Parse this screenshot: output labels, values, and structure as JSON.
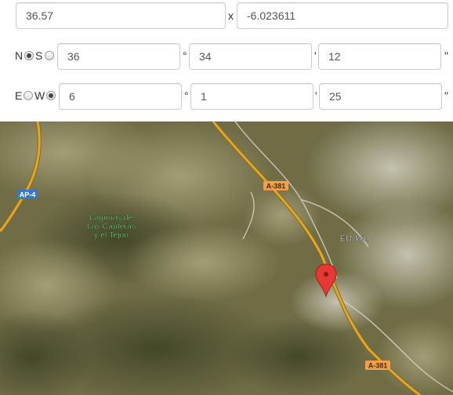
{
  "coordinates": {
    "lat_decimal": "36.57",
    "separator": "x",
    "lng_decimal": "-6.023611"
  },
  "latitude_row": {
    "north_label": "N",
    "south_label": "S",
    "selected": "N",
    "degrees": "36",
    "minutes": "34",
    "seconds": "12",
    "degree_symbol": "°",
    "minute_symbol": "'",
    "second_symbol": "\""
  },
  "longitude_row": {
    "east_label": "E",
    "west_label": "W",
    "selected": "W",
    "degrees": "6",
    "minutes": "1",
    "seconds": "25",
    "degree_symbol": "°",
    "minute_symbol": "'",
    "second_symbol": "\""
  },
  "map": {
    "type": "satellite",
    "labels": {
      "place_line1": "Lagunas de",
      "place_line2": "Las Canteras",
      "place_line3": "y el Tejón",
      "town": "El Mojo",
      "road_ap4": "AP-4",
      "road_a381_top": "A-381",
      "road_a381_bottom": "A-381"
    },
    "colors": {
      "road": "#d9a227",
      "shield_orange": "#f0a04b",
      "shield_blue": "#3a78c3",
      "place_label": "#8ef0a0",
      "marker": "#e53935"
    },
    "marker_icon": "map-pin-icon"
  }
}
